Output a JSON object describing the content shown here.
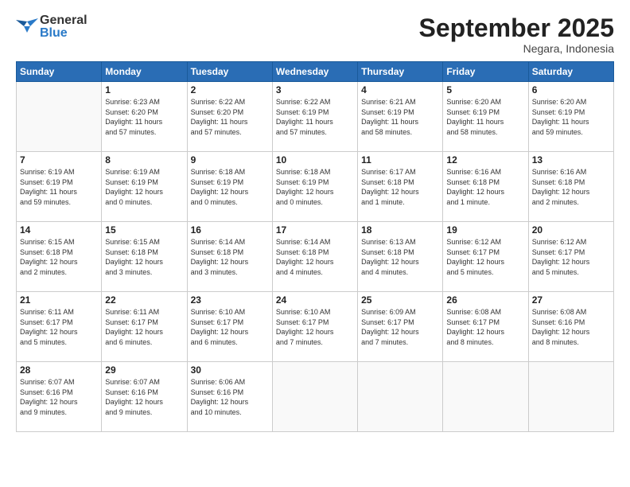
{
  "header": {
    "logo_general": "General",
    "logo_blue": "Blue",
    "month_title": "September 2025",
    "subtitle": "Negara, Indonesia"
  },
  "weekdays": [
    "Sunday",
    "Monday",
    "Tuesday",
    "Wednesday",
    "Thursday",
    "Friday",
    "Saturday"
  ],
  "weeks": [
    [
      {
        "num": "",
        "info": ""
      },
      {
        "num": "1",
        "info": "Sunrise: 6:23 AM\nSunset: 6:20 PM\nDaylight: 11 hours\nand 57 minutes."
      },
      {
        "num": "2",
        "info": "Sunrise: 6:22 AM\nSunset: 6:20 PM\nDaylight: 11 hours\nand 57 minutes."
      },
      {
        "num": "3",
        "info": "Sunrise: 6:22 AM\nSunset: 6:19 PM\nDaylight: 11 hours\nand 57 minutes."
      },
      {
        "num": "4",
        "info": "Sunrise: 6:21 AM\nSunset: 6:19 PM\nDaylight: 11 hours\nand 58 minutes."
      },
      {
        "num": "5",
        "info": "Sunrise: 6:20 AM\nSunset: 6:19 PM\nDaylight: 11 hours\nand 58 minutes."
      },
      {
        "num": "6",
        "info": "Sunrise: 6:20 AM\nSunset: 6:19 PM\nDaylight: 11 hours\nand 59 minutes."
      }
    ],
    [
      {
        "num": "7",
        "info": "Sunrise: 6:19 AM\nSunset: 6:19 PM\nDaylight: 11 hours\nand 59 minutes."
      },
      {
        "num": "8",
        "info": "Sunrise: 6:19 AM\nSunset: 6:19 PM\nDaylight: 12 hours\nand 0 minutes."
      },
      {
        "num": "9",
        "info": "Sunrise: 6:18 AM\nSunset: 6:19 PM\nDaylight: 12 hours\nand 0 minutes."
      },
      {
        "num": "10",
        "info": "Sunrise: 6:18 AM\nSunset: 6:19 PM\nDaylight: 12 hours\nand 0 minutes."
      },
      {
        "num": "11",
        "info": "Sunrise: 6:17 AM\nSunset: 6:18 PM\nDaylight: 12 hours\nand 1 minute."
      },
      {
        "num": "12",
        "info": "Sunrise: 6:16 AM\nSunset: 6:18 PM\nDaylight: 12 hours\nand 1 minute."
      },
      {
        "num": "13",
        "info": "Sunrise: 6:16 AM\nSunset: 6:18 PM\nDaylight: 12 hours\nand 2 minutes."
      }
    ],
    [
      {
        "num": "14",
        "info": "Sunrise: 6:15 AM\nSunset: 6:18 PM\nDaylight: 12 hours\nand 2 minutes."
      },
      {
        "num": "15",
        "info": "Sunrise: 6:15 AM\nSunset: 6:18 PM\nDaylight: 12 hours\nand 3 minutes."
      },
      {
        "num": "16",
        "info": "Sunrise: 6:14 AM\nSunset: 6:18 PM\nDaylight: 12 hours\nand 3 minutes."
      },
      {
        "num": "17",
        "info": "Sunrise: 6:14 AM\nSunset: 6:18 PM\nDaylight: 12 hours\nand 4 minutes."
      },
      {
        "num": "18",
        "info": "Sunrise: 6:13 AM\nSunset: 6:18 PM\nDaylight: 12 hours\nand 4 minutes."
      },
      {
        "num": "19",
        "info": "Sunrise: 6:12 AM\nSunset: 6:17 PM\nDaylight: 12 hours\nand 5 minutes."
      },
      {
        "num": "20",
        "info": "Sunrise: 6:12 AM\nSunset: 6:17 PM\nDaylight: 12 hours\nand 5 minutes."
      }
    ],
    [
      {
        "num": "21",
        "info": "Sunrise: 6:11 AM\nSunset: 6:17 PM\nDaylight: 12 hours\nand 5 minutes."
      },
      {
        "num": "22",
        "info": "Sunrise: 6:11 AM\nSunset: 6:17 PM\nDaylight: 12 hours\nand 6 minutes."
      },
      {
        "num": "23",
        "info": "Sunrise: 6:10 AM\nSunset: 6:17 PM\nDaylight: 12 hours\nand 6 minutes."
      },
      {
        "num": "24",
        "info": "Sunrise: 6:10 AM\nSunset: 6:17 PM\nDaylight: 12 hours\nand 7 minutes."
      },
      {
        "num": "25",
        "info": "Sunrise: 6:09 AM\nSunset: 6:17 PM\nDaylight: 12 hours\nand 7 minutes."
      },
      {
        "num": "26",
        "info": "Sunrise: 6:08 AM\nSunset: 6:17 PM\nDaylight: 12 hours\nand 8 minutes."
      },
      {
        "num": "27",
        "info": "Sunrise: 6:08 AM\nSunset: 6:16 PM\nDaylight: 12 hours\nand 8 minutes."
      }
    ],
    [
      {
        "num": "28",
        "info": "Sunrise: 6:07 AM\nSunset: 6:16 PM\nDaylight: 12 hours\nand 9 minutes."
      },
      {
        "num": "29",
        "info": "Sunrise: 6:07 AM\nSunset: 6:16 PM\nDaylight: 12 hours\nand 9 minutes."
      },
      {
        "num": "30",
        "info": "Sunrise: 6:06 AM\nSunset: 6:16 PM\nDaylight: 12 hours\nand 10 minutes."
      },
      {
        "num": "",
        "info": ""
      },
      {
        "num": "",
        "info": ""
      },
      {
        "num": "",
        "info": ""
      },
      {
        "num": "",
        "info": ""
      }
    ]
  ]
}
